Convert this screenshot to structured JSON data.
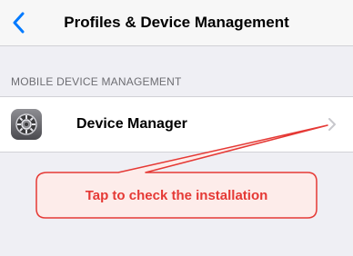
{
  "navbar": {
    "back_icon": "chevron-left-icon",
    "title": "Profiles & Device Management"
  },
  "section": {
    "header": "MOBILE DEVICE MANAGEMENT"
  },
  "row": {
    "icon": "settings-gear-icon",
    "label": "Device Manager",
    "disclosure_icon": "chevron-right-icon"
  },
  "callout": {
    "text": "Tap to check the installation",
    "text_color": "#e53935",
    "border_color": "#e53935",
    "fill_color": "#fdecea"
  },
  "colors": {
    "accent": "#007aff",
    "background": "#efeff4"
  }
}
